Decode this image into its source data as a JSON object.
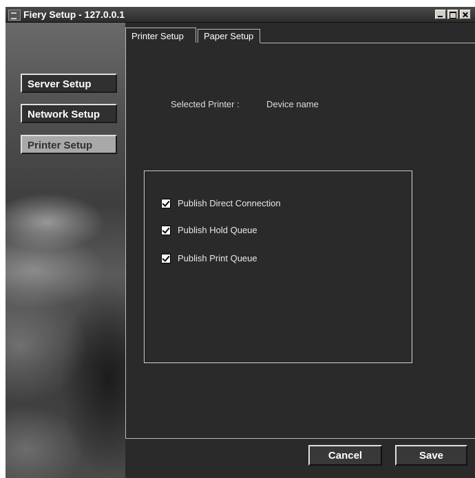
{
  "window": {
    "title": "Fiery Setup - 127.0.0.1"
  },
  "sidebar": {
    "items": [
      {
        "label": "Server Setup",
        "active": false
      },
      {
        "label": "Network Setup",
        "active": false
      },
      {
        "label": "Printer Setup",
        "active": true
      }
    ]
  },
  "tabs": [
    {
      "label": "Printer Setup",
      "selected": true
    },
    {
      "label": "Paper Setup",
      "selected": false
    }
  ],
  "printer": {
    "selected_label": "Selected Printer :",
    "selected_value": "Device name"
  },
  "options": [
    {
      "label": "Publish Direct Connection",
      "checked": true
    },
    {
      "label": "Publish Hold Queue",
      "checked": true
    },
    {
      "label": "Publish Print Queue",
      "checked": true
    }
  ],
  "actions": {
    "cancel_label": "Cancel",
    "save_label": "Save"
  }
}
